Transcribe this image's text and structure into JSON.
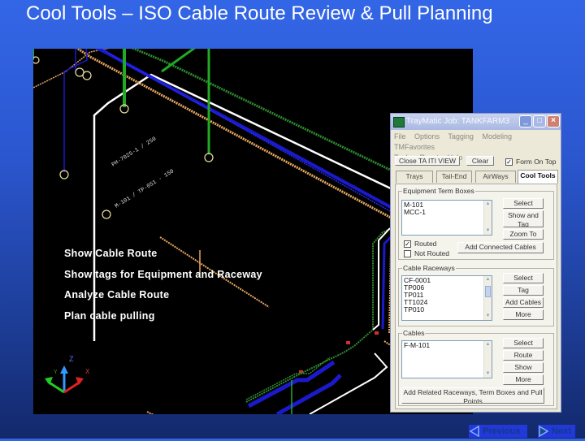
{
  "slide": {
    "title": "Cool Tools – ISO Cable Route Review & Pull Planning",
    "bullets": [
      "Show Cable Route",
      "Show tags for Equipment and Raceway",
      "Analyze Cable Route",
      "Plan cable pulling"
    ],
    "nav": {
      "previous": "Previous",
      "next": "Next"
    }
  },
  "cad_view": {
    "axis_labels": {
      "x": "X",
      "y": "Y",
      "z": "Z"
    },
    "colors": {
      "background": "#000000",
      "tray_green": "#2e8b2e",
      "tray_blue": "#1a1acc",
      "tray_orange": "#e8a860",
      "cable_white": "#ffffff",
      "riser_green": "#22aa22"
    }
  },
  "dialog": {
    "title": "TrayMatic  Job: TANKFARM3",
    "menu": [
      "File",
      "Options",
      "Tagging",
      "Modeling",
      "TMFavorites",
      "Tools",
      "Reset",
      "Help"
    ],
    "toolbar": {
      "close_view": "Close TA ITI VIEW",
      "clear": "Clear",
      "form_on_top_label": "Form On Top",
      "form_on_top_checked": true
    },
    "tabs": [
      "Trays",
      "Tail-End",
      "AirWays",
      "Cool Tools"
    ],
    "active_tab": "Cool Tools",
    "equipment": {
      "label": "Equipment Term Boxes",
      "items": [
        "M-101",
        "MCC-1"
      ],
      "buttons": {
        "select": "Select",
        "show_tag": "Show and Tag",
        "zoom_to": "Zoom To",
        "add_connected": "Add Connected Cables"
      },
      "routed_label": "Routed",
      "routed_checked": true,
      "not_routed_label": "Not Routed",
      "not_routed_checked": false
    },
    "raceways": {
      "label": "Cable Raceways",
      "items": [
        "CF-0001",
        "TP006",
        "TP011",
        "TT1024",
        "TP010"
      ],
      "buttons": {
        "select": "Select",
        "tag": "Tag",
        "add_cables": "Add Cables",
        "more": "More"
      }
    },
    "cables": {
      "label": "Cables",
      "items": [
        "F-M-101"
      ],
      "buttons": {
        "select": "Select",
        "route": "Route",
        "show": "Show",
        "more": "More"
      },
      "add_related": "Add Related Raceways, Term Boxes and Pull Points"
    }
  }
}
